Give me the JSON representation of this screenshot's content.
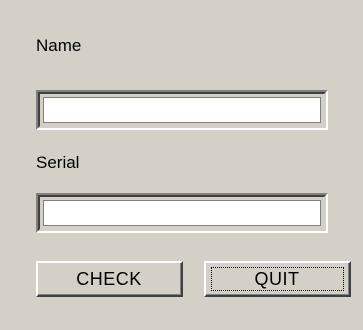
{
  "form": {
    "name_label": "Name",
    "name_value": "",
    "serial_label": "Serial",
    "serial_value": ""
  },
  "buttons": {
    "check_label": "CHECK",
    "quit_label": "QUIT",
    "focused": "quit"
  },
  "colors": {
    "window_bg": "#d4d0c8",
    "field_bg": "#ffffff",
    "shadow": "#808080",
    "dark_shadow": "#404040",
    "highlight": "#ffffff"
  }
}
